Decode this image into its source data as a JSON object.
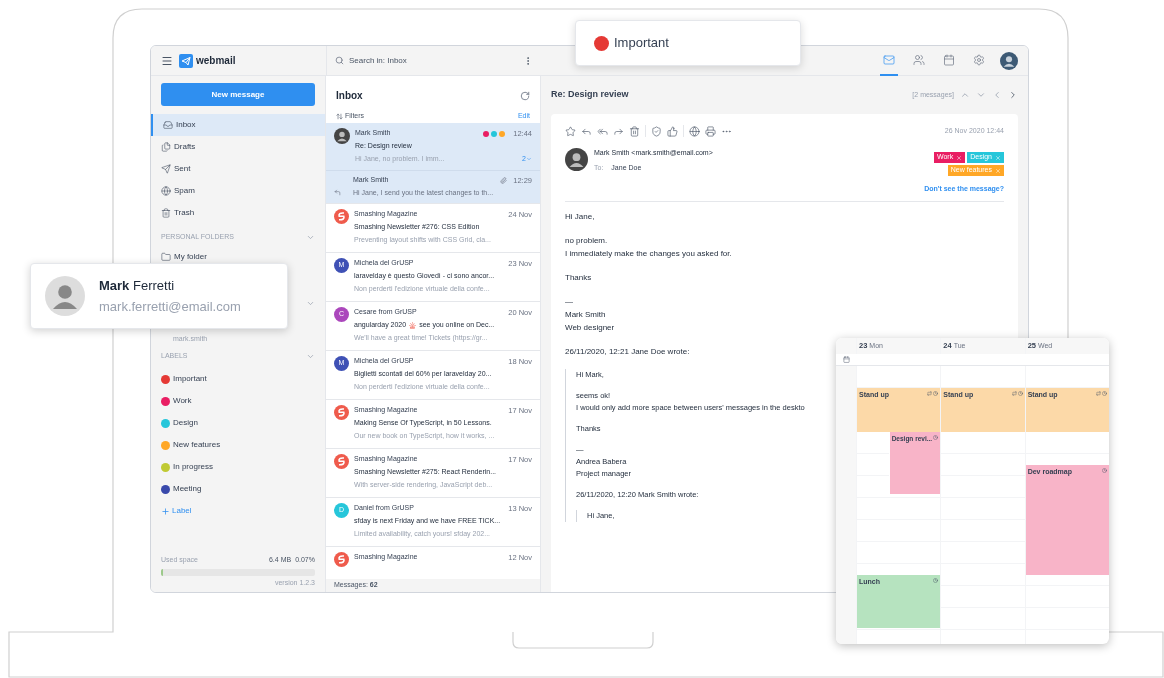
{
  "floating_label": {
    "label": "Important",
    "color": "#e53935"
  },
  "contact_card": {
    "name": "**Mark** Ferretti",
    "email": "mark.ferretti@email.com"
  },
  "app": {
    "logo": "webmail",
    "search": {
      "placeholder": "Search in: Inbox"
    },
    "top_nav": [
      {
        "kind": "mail",
        "selected": true
      },
      {
        "kind": "contacts",
        "selected": false
      },
      {
        "kind": "calendar",
        "selected": false
      },
      {
        "kind": "settings",
        "selected": false
      }
    ],
    "sidebar": {
      "new_message": "New message",
      "folders": [
        {
          "kind": "inbox",
          "label": "Inbox",
          "selected": true
        },
        {
          "kind": "drafts",
          "label": "Drafts",
          "selected": false
        },
        {
          "kind": "sent",
          "label": "Sent",
          "selected": false
        },
        {
          "kind": "spam",
          "label": "Spam",
          "selected": false
        },
        {
          "kind": "trash",
          "label": "Trash",
          "selected": false
        }
      ],
      "personal_folders": {
        "title": "PERSONAL FOLDERS",
        "items": [
          {
            "label": "My folder"
          }
        ]
      },
      "shared_item": "mark.smith",
      "labels": {
        "title": "LABELS",
        "items": [
          {
            "label": "Important",
            "color": "#e53935"
          },
          {
            "label": "Work",
            "color": "#e91e63"
          },
          {
            "label": "Design",
            "color": "#26c6da"
          },
          {
            "label": "New features",
            "color": "#ffa726"
          },
          {
            "label": "In progress",
            "color": "#c0ca33"
          },
          {
            "label": "Meeting",
            "color": "#3949ab"
          }
        ],
        "add": "Label"
      },
      "used_space": {
        "label": "Used space",
        "size": "6.4 MB",
        "percent": "0.07%",
        "level": 0.01
      },
      "version": "version 1.2.3"
    },
    "message_list": {
      "title": "Inbox",
      "filters": "Filters",
      "edit": "Edit",
      "thread": {
        "sender": "Mark Smith",
        "time": "12:44",
        "subject": "Re: Design review",
        "preview": "Hi Jane, no problem. I imm...",
        "count": "2",
        "selected": true,
        "tags": [
          {
            "color": "#e91e63"
          },
          {
            "color": "#26c6da"
          },
          {
            "color": "#ffa726"
          }
        ],
        "reply": {
          "sender": "Mark Smith",
          "time": "12:29",
          "preview": "Hi Jane, I send you the latest changes to th..."
        }
      },
      "messages": [
        {
          "kind": "logo",
          "color": "#ef5b4c",
          "sender": "Smashing Magazine",
          "date": "24 Nov",
          "subject": "Smashing Newsletter #276: CSS Edition",
          "preview": "Preventing layout shifts with CSS Grid, cla..."
        },
        {
          "kind": "letter",
          "initial": "M",
          "color": "#3f51b5",
          "sender": "Michela del GrUSP",
          "date": "23 Nov",
          "subject": "laravelday è questo Giovedì - ci sono ancor...",
          "preview": "Non perderti l'edizione virtuale della confe..."
        },
        {
          "kind": "letter",
          "initial": "C",
          "color": "#ab47bc",
          "sender": "Cesare from GrUSP",
          "date": "20 Nov",
          "subject": "angularday 2020",
          "subject_icon": true,
          "subject_rest": "see you online on Dec...",
          "preview": "We'll have a great time!  Tickets (https://gr..."
        },
        {
          "kind": "letter",
          "initial": "M",
          "color": "#3f51b5",
          "sender": "Michela del GrUSP",
          "date": "18 Nov",
          "subject": "Biglietti scontati del 60% per laravelday 20...",
          "preview": "Non perderti l'edizione virtuale della confe..."
        },
        {
          "kind": "logo",
          "color": "#ef5b4c",
          "sender": "Smashing Magazine",
          "date": "17 Nov",
          "subject": "Making Sense Of TypeScript, in 50 Lessons.",
          "preview": "Our new book on TypeScript, how it works, ..."
        },
        {
          "kind": "logo",
          "color": "#ef5b4c",
          "sender": "Smashing Magazine",
          "date": "17 Nov",
          "subject": "Smashing Newsletter #275: React Renderin...",
          "preview": "With server-side rendering, JavaScript deb..."
        },
        {
          "kind": "letter",
          "initial": "D",
          "color": "#26c6da",
          "sender": "Daniel from GrUSP",
          "date": "13 Nov",
          "subject": "sfday is next Friday and we have FREE TICK...",
          "preview": "Limited availability, catch yours!  sfday 202..."
        },
        {
          "kind": "logo",
          "color": "#ef5b4c",
          "sender": "Smashing Magazine",
          "date": "12 Nov"
        }
      ],
      "footer_label": "Messages:",
      "footer_count": "62"
    },
    "reading": {
      "title": "Re: Design review",
      "count": "[2 messages]",
      "date": "26 Nov 2020 12:44",
      "from": "Mark Smith <mark.smith@email.com>",
      "to_label": "To:",
      "to": "Jane Doe",
      "tags": [
        {
          "label": "Work",
          "color": "#e91e63"
        },
        {
          "label": "Design",
          "color": "#26c6da"
        },
        {
          "label": "New features",
          "color": "#ffa726"
        }
      ],
      "link": "Don't see the message?",
      "body": [
        [
          "Hi Jane,"
        ],
        [
          "no problem.",
          "I immediately make the changes you asked for."
        ],
        [
          "Thanks"
        ],
        [
          "—",
          "Mark Smith",
          "Web designer"
        ],
        [
          "26/11/2020, 12:21 Jane Doe wrote:"
        ]
      ],
      "quote": [
        [
          "Hi Mark,"
        ],
        [
          "seems ok!",
          "I would only add more space between users' messages in the deskto"
        ],
        [
          "Thanks"
        ],
        [
          "—",
          "Andrea Babera",
          "Project manager"
        ],
        [
          "26/11/2020, 12:20 Mark Smith  wrote:"
        ]
      ],
      "nested_quote": [
        "Hi Jane,"
      ]
    }
  },
  "calendar": {
    "days": [
      {
        "day": "23",
        "weekday": "Mon",
        "events": [
          {
            "title": "Stand up",
            "color": "#fcd9a8",
            "recurring": true
          },
          {
            "title": "Design revi...",
            "color": "#f8b4c8",
            "recurring": false
          },
          {
            "title": "Lunch",
            "color": "#b6e3bf",
            "recurring": false
          }
        ]
      },
      {
        "day": "24",
        "weekday": "Tue",
        "events": [
          {
            "title": "Stand up",
            "color": "#fcd9a8",
            "recurring": true
          }
        ]
      },
      {
        "day": "25",
        "weekday": "Wed",
        "events": [
          {
            "title": "Stand up",
            "color": "#fcd9a8",
            "recurring": true
          },
          {
            "title": "Dev roadmap",
            "color": "#f8b4c8",
            "recurring": false
          }
        ]
      }
    ]
  }
}
